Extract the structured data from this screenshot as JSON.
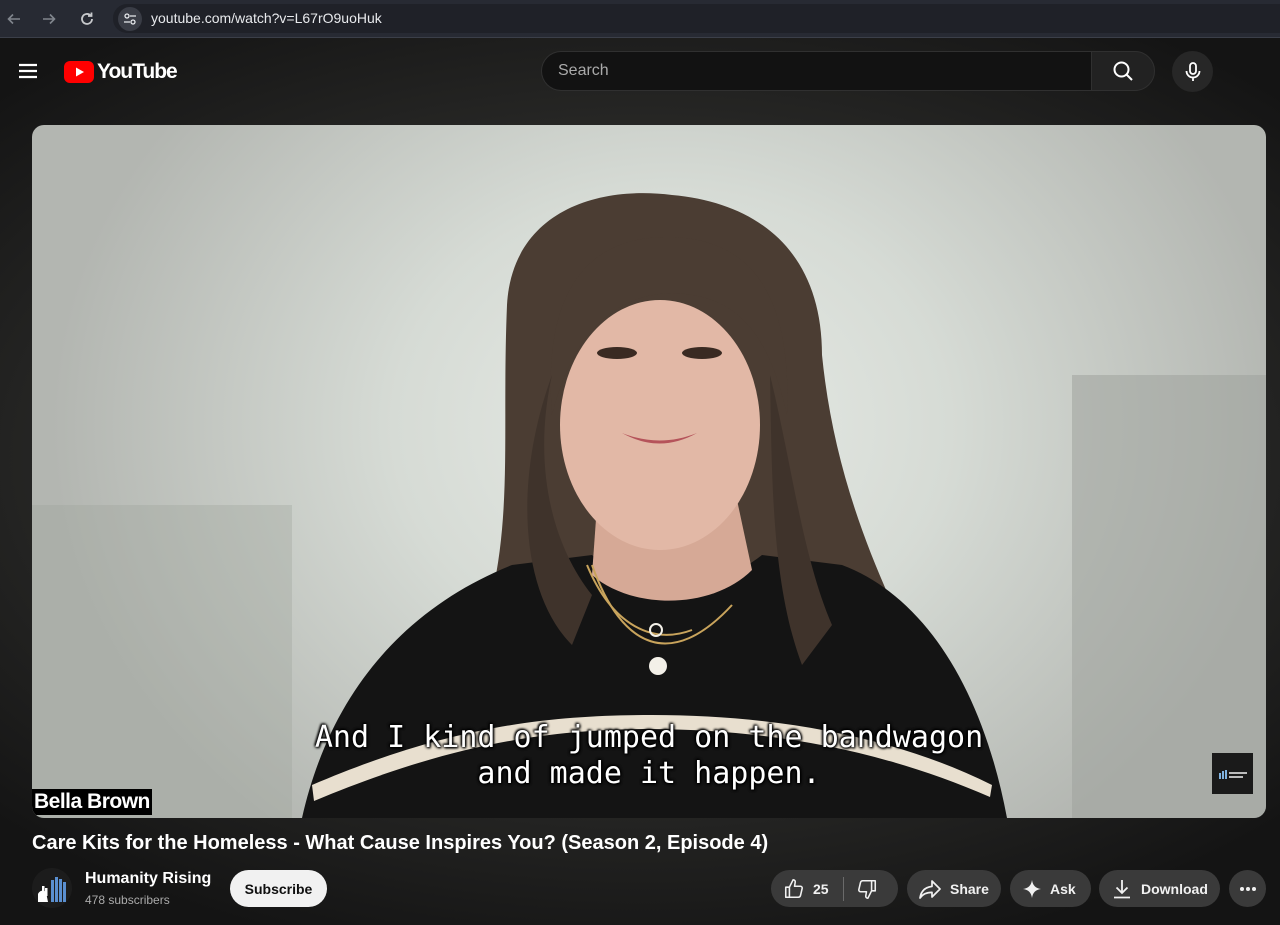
{
  "browser": {
    "url": "youtube.com/watch?v=L67rO9uoHuk",
    "back_icon": "arrow-left-icon",
    "forward_icon": "arrow-right-icon",
    "reload_icon": "reload-icon",
    "site_info_icon": "tune-icon"
  },
  "masthead": {
    "menu_icon": "hamburger-menu-icon",
    "logo_text": "YouTube",
    "search_placeholder": "Search",
    "search_value": "",
    "search_icon": "search-icon",
    "mic_icon": "microphone-icon"
  },
  "player": {
    "caption_line1": "And I kind of jumped on the bandwagon",
    "caption_line2": "and made it happen.",
    "name_tag": "Bella Brown",
    "watermark_text": "Humanity Rising"
  },
  "video": {
    "title": "Care Kits for the Homeless - What Cause Inspires You? (Season 2, Episode 4)"
  },
  "channel": {
    "name": "Humanity Rising",
    "subscribers": "478 subscribers",
    "subscribe_label": "Subscribe"
  },
  "actions": {
    "like_count": "25",
    "share_label": "Share",
    "ask_label": "Ask",
    "download_label": "Download",
    "like_icon": "thumbs-up-icon",
    "dislike_icon": "thumbs-down-icon",
    "share_icon": "share-arrow-icon",
    "ask_icon": "sparkle-icon",
    "download_icon": "download-icon",
    "more_icon": "more-horizontal-icon"
  },
  "colors": {
    "brand_red": "#ff0000",
    "page_bg": "#0f0f0f",
    "pill_bg": "#3a3a3a",
    "subscribe_bg": "#f1f1f1"
  }
}
